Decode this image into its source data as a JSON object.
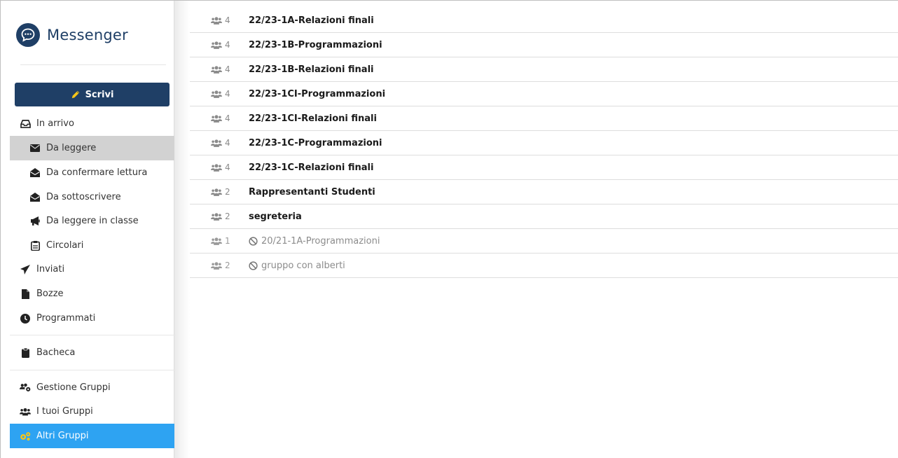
{
  "app": {
    "title": "Messenger",
    "accent": "#1f3f66",
    "active_blue": "#2ea3f2"
  },
  "compose": {
    "label": "Scrivi",
    "icon": "pencil-icon",
    "icon_color": "#f5c518"
  },
  "sidebar": {
    "inbox": {
      "label": "In arrivo",
      "icon": "inbox-icon"
    },
    "inbox_items": [
      {
        "label": "Da leggere",
        "icon": "envelope-icon",
        "active": true
      },
      {
        "label": "Da confermare lettura",
        "icon": "envelope-open-icon"
      },
      {
        "label": "Da sottoscrivere",
        "icon": "envelope-open-icon"
      },
      {
        "label": "Da leggere in classe",
        "icon": "megaphone-icon"
      },
      {
        "label": "Circolari",
        "icon": "clipboard-icon"
      }
    ],
    "sent": {
      "label": "Inviati",
      "icon": "send-icon"
    },
    "drafts": {
      "label": "Bozze",
      "icon": "file-icon"
    },
    "scheduled": {
      "label": "Programmati",
      "icon": "clock-icon"
    },
    "board": {
      "label": "Bacheca",
      "icon": "clipboard-icon"
    },
    "manage_groups": {
      "label": "Gestione Gruppi",
      "icon": "users-gear-icon"
    },
    "my_groups": {
      "label": "I tuoi Gruppi",
      "icon": "users-icon"
    },
    "other_groups": {
      "label": "Altri Gruppi",
      "icon": "gears-icon",
      "active": true
    }
  },
  "groups": [
    {
      "count": "4",
      "name": "22/23-1A-Relazioni finali",
      "disabled": false
    },
    {
      "count": "4",
      "name": "22/23-1B-Programmazioni",
      "disabled": false
    },
    {
      "count": "4",
      "name": "22/23-1B-Relazioni finali",
      "disabled": false
    },
    {
      "count": "4",
      "name": "22/23-1CI-Programmazioni",
      "disabled": false
    },
    {
      "count": "4",
      "name": "22/23-1CI-Relazioni finali",
      "disabled": false
    },
    {
      "count": "4",
      "name": "22/23-1C-Programmazioni",
      "disabled": false
    },
    {
      "count": "4",
      "name": "22/23-1C-Relazioni finali",
      "disabled": false
    },
    {
      "count": "2",
      "name": "Rappresentanti Studenti",
      "disabled": false
    },
    {
      "count": "2",
      "name": "segreteria",
      "disabled": false
    },
    {
      "count": "1",
      "name": "20/21-1A-Programmazioni",
      "disabled": true
    },
    {
      "count": "2",
      "name": "gruppo con alberti",
      "disabled": true
    }
  ]
}
